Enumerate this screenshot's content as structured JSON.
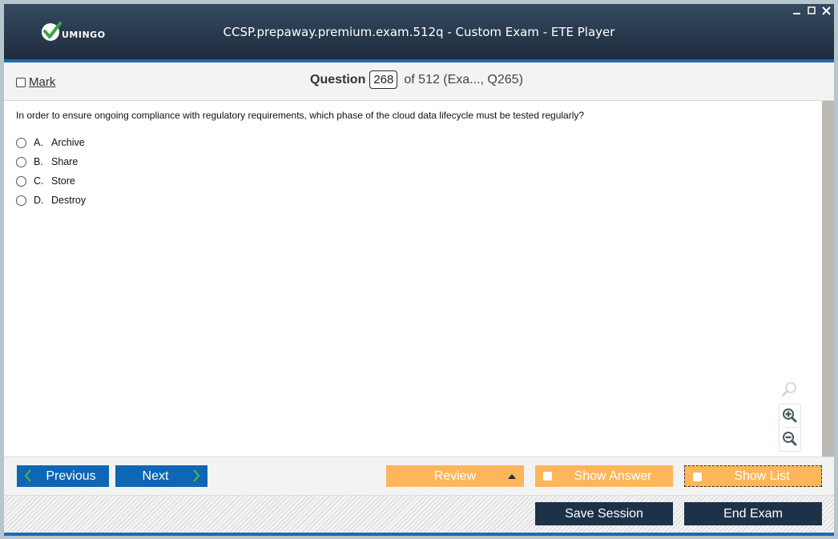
{
  "window": {
    "title": "CCSP.prepaway.premium.exam.512q - Custom Exam - ETE Player",
    "logo_text": "UMINGO",
    "controls": [
      "minimize-icon",
      "maximize-icon",
      "close-icon"
    ]
  },
  "question_bar": {
    "mark_label": "Mark",
    "mark_checked": false,
    "question_label": "Question",
    "question_number": "268",
    "question_suffix": "of 512 (Exa..., Q265)"
  },
  "question": {
    "text": "In order to ensure ongoing compliance with regulatory requirements, which phase of the cloud data lifecycle must be tested regularly?",
    "options": [
      {
        "letter": "A.",
        "text": "Archive",
        "selected": false
      },
      {
        "letter": "B.",
        "text": "Share",
        "selected": false
      },
      {
        "letter": "C.",
        "text": "Store",
        "selected": false
      },
      {
        "letter": "D.",
        "text": "Destroy",
        "selected": false
      }
    ]
  },
  "zoom_tools": [
    "search-icon",
    "zoom-in-icon",
    "zoom-out-icon"
  ],
  "nav": {
    "previous_label": "Previous",
    "next_label": "Next",
    "review_label": "Review",
    "show_answer_label": "Show Answer",
    "show_list_label": "Show List"
  },
  "footer": {
    "save_session_label": "Save Session",
    "end_exam_label": "End Exam"
  },
  "colors": {
    "title_bar": "#1f2c3d",
    "accent_blue": "#1c69b8",
    "nav_blue": "#0d67b6",
    "orange": "#ffb65a",
    "dark_button": "#1c3249",
    "chevron_green": "#4caf50"
  }
}
